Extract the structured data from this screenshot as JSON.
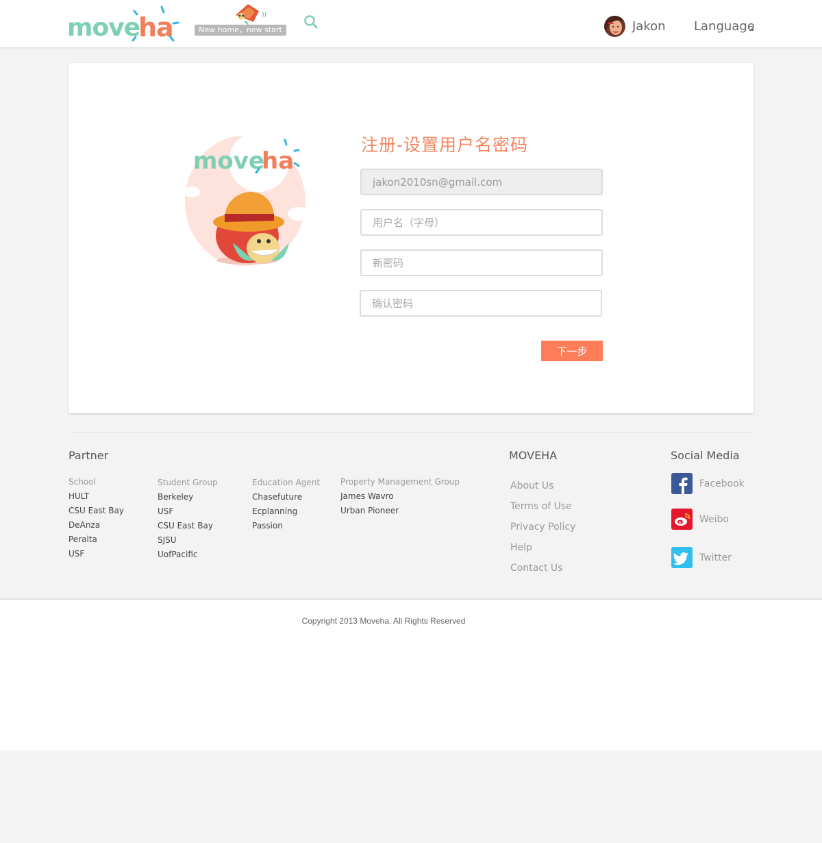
{
  "header": {
    "logo_part1": "move",
    "logo_part2": "ha",
    "slogan": "New home，new start",
    "user_name": "Jakon",
    "language_label": "Language"
  },
  "form": {
    "title": "注册-设置用户名密码",
    "email_value": "jakon2010sn@gmail.com",
    "username_placeholder": "用户名（字母）",
    "password_placeholder": "新密码",
    "confirm_placeholder": "确认密码",
    "next_label": "下一步",
    "mascot_logo_part1": "move",
    "mascot_logo_part2": "ha"
  },
  "footer": {
    "partner_title": "Partner",
    "partner_columns": [
      {
        "heading": "School",
        "items": [
          "HULT",
          "CSU East Bay",
          "DeAnza",
          "Peralta",
          "USF"
        ]
      },
      {
        "heading": "Student Group",
        "items": [
          "Berkeley",
          "USF",
          "CSU East Bay",
          "SJSU",
          "UofPacific"
        ]
      },
      {
        "heading": "Education Agent",
        "items": [
          "Chasefuture",
          "Ecplanning",
          "Passion"
        ]
      },
      {
        "heading": "Property Management Group",
        "items": [
          "James Wavro",
          "Urban Pioneer"
        ]
      }
    ],
    "moveha_title": "MOVEHA",
    "moveha_links": [
      "About Us",
      "Terms of Use",
      "Privacy Policy",
      "Help",
      "Contact Us"
    ],
    "social_title": "Social Media",
    "social": [
      {
        "label": "Facebook",
        "icon": "facebook-icon",
        "color": "#3b5998"
      },
      {
        "label": "Weibo",
        "icon": "weibo-icon",
        "color": "#e6162d"
      },
      {
        "label": "Twitter",
        "icon": "twitter-icon",
        "color": "#2fbfee"
      }
    ],
    "copyright": "Copyright 2013 Moveha.  All Rights Reserved"
  },
  "colors": {
    "accent": "#fd7d58",
    "brand_green": "#7ed0b2",
    "brand_orange": "#f37e5a"
  }
}
